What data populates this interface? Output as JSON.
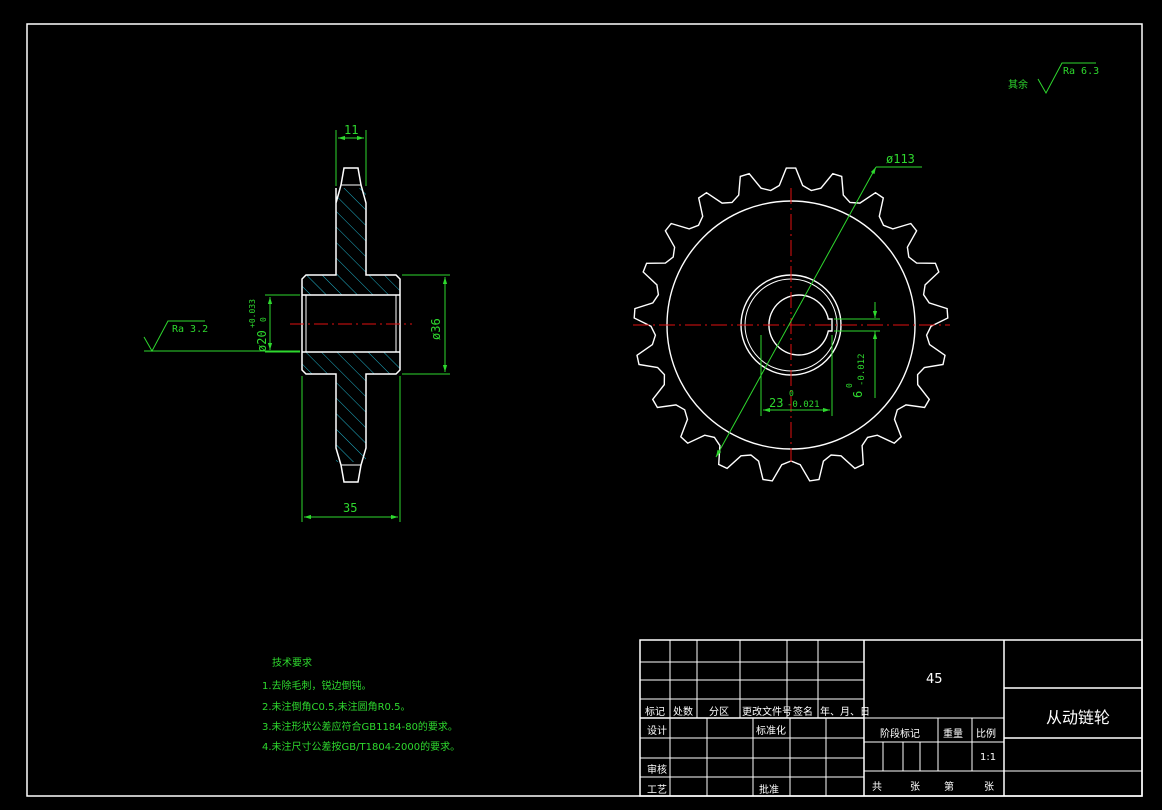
{
  "drawing": {
    "roughness_default": {
      "prefix": "其余",
      "value": "Ra 6.3"
    },
    "roughness_bore": "Ra 3.2",
    "dimensions": {
      "thickness": "11",
      "hub_length": "35",
      "hub_dia": "ø36",
      "bore": "ø20",
      "bore_tol_upper": "+0.033",
      "bore_tol_lower": "0",
      "outer_dia": "ø113",
      "keyway_depth": "23",
      "keyway_depth_tol_upper": "0",
      "keyway_depth_tol_lower": "-0.021",
      "keyway_width": "6",
      "keyway_width_tol_upper": "0",
      "keyway_width_tol_lower": "-0.012"
    },
    "colors": {
      "outline": "#ffffff",
      "dimension": "#2ed82e",
      "centerline": "#e01010",
      "hatch": "#1fb0c8",
      "frame": "#ffffff"
    }
  },
  "technical_requirements": {
    "title": "技术要求",
    "items": [
      "1.去除毛刺，锐边倒钝。",
      "2.未注倒角C0.5,未注圆角R0.5。",
      "3.未注形状公差应符合GB1184-80的要求。",
      "4.未注尺寸公差按GB/T1804-2000的要求。"
    ]
  },
  "title_block": {
    "material": "45",
    "part_name": "从动链轮",
    "revision_headers": [
      "标记",
      "处数",
      "分区",
      "更改文件号",
      "签名",
      "年、月、日"
    ],
    "design": "设计",
    "standardization": "标准化",
    "review": "审核",
    "process": "工艺",
    "approve": "批准",
    "stage_mark": "阶段标记",
    "weight": "重量",
    "scale": "比例",
    "scale_value": "1:1",
    "sheet_total_label": "共",
    "sheet_label": "张",
    "sheet_no_label": "第",
    "sheet_label2": "张"
  }
}
